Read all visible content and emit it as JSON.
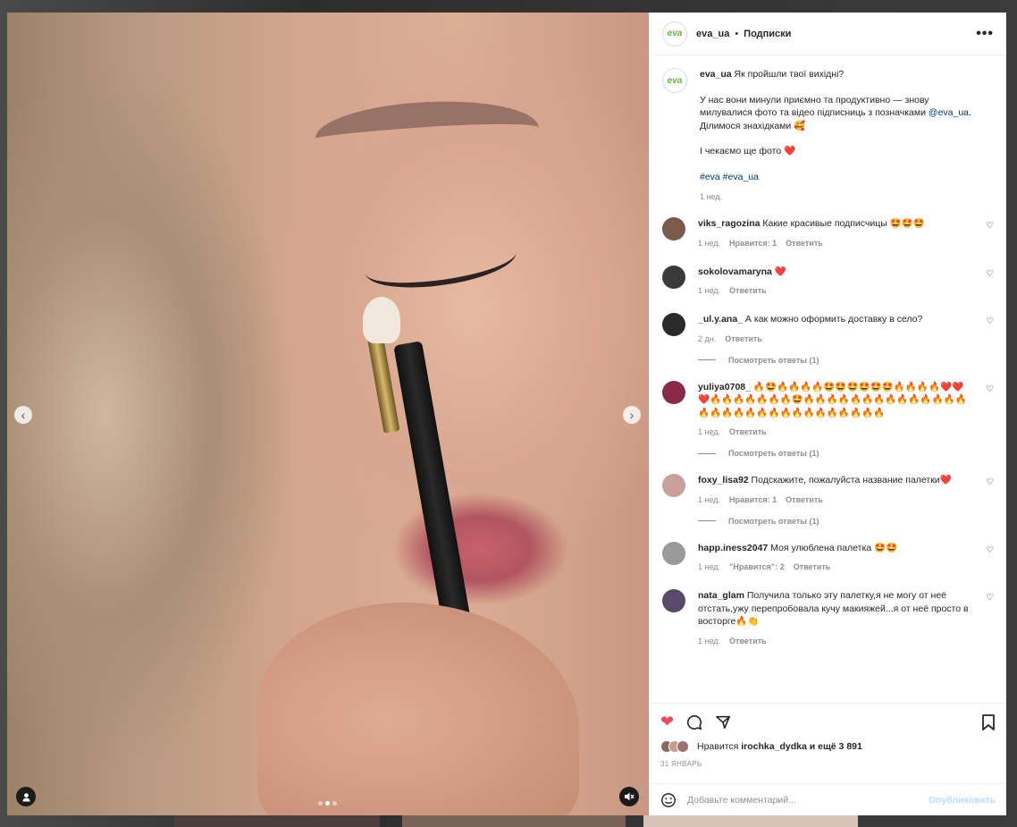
{
  "post": {
    "author": "eva_ua",
    "logo_text": "eva",
    "separator": "•",
    "follow_label": "Подписки",
    "more_icon": "•••",
    "caption": {
      "author": "eva_ua",
      "line1": "Як пройшли твої вихідні?",
      "line2a": "У нас вони минули приємно та продуктивно — знову милувалися фото та відео підписниць з позначками ",
      "mention": "@eva_ua",
      "line2b": ". Ділимося знахідками 🥰",
      "line3": "І чекаємо ще фото ❤️",
      "hashtags": "#eva #eva_ua",
      "time": "1 нед."
    }
  },
  "comments": [
    {
      "user": "viks_ragozina",
      "text": "Какие красивые подписчицы 🤩🤩🤩",
      "time": "1 нед.",
      "likes": "Нравится: 1",
      "reply": "Ответить",
      "avatar_color": "#7a5a4a"
    },
    {
      "user": "sokolovamaryna",
      "text": "❤️",
      "time": "1 нед.",
      "reply": "Ответить",
      "avatar_color": "#3a3a3a"
    },
    {
      "user": "_ul.y.ana_",
      "text": "А как можно оформить доставку в село?",
      "time": "2 дн.",
      "reply": "Ответить",
      "avatar_color": "#2a2a2a",
      "view_replies": "Посмотреть ответы (1)"
    },
    {
      "user": "yuliya0708_",
      "text": "🔥🤩🔥🔥🔥🔥🤩🤩🤩🤩🤩🤩🔥🔥🔥🔥❤️❤️❤️🔥🔥🔥🔥🔥🔥🔥🤩🔥🔥🔥🔥🔥🔥🔥🔥🔥🔥🔥🔥🔥🔥🔥🔥🔥🔥🔥🔥🔥🔥🔥🔥🔥🔥🔥🔥🔥🔥",
      "time": "1 нед.",
      "reply": "Ответить",
      "avatar_color": "#8a2a4a",
      "view_replies": "Посмотреть ответы (1)"
    },
    {
      "user": "foxy_lisa92",
      "text": "Подскажите, пожалуйста название палетки❤️",
      "time": "1 нед.",
      "likes": "Нравится: 1",
      "reply": "Ответить",
      "avatar_color": "#c9a09a",
      "view_replies": "Посмотреть ответы (1)"
    },
    {
      "user": "happ.iness2047",
      "text": "Моя улюблена палетка 🤩🤩",
      "time": "1 нед.",
      "likes": "\"Нравится\": 2",
      "reply": "Ответить",
      "avatar_color": "#9a9a9a"
    },
    {
      "user": "nata_glam",
      "text": "Получила только эту палетку,я не могу от неё отстать,ужу перепробовала кучу макияжей...я от неё просто в восторге🔥👏",
      "time": "1 нед.",
      "reply": "Ответить",
      "avatar_color": "#5a4a6a"
    }
  ],
  "actions": {
    "likes_prefix": "Нравится",
    "likes_user": "irochka_dydka",
    "likes_suffix": "и ещё 3 891",
    "date": "31 ЯНВАРЬ"
  },
  "composer": {
    "placeholder": "Добавьте комментарий...",
    "publish": "Опубликовать"
  },
  "media": {
    "left_arrow": "‹",
    "right_arrow": "›"
  }
}
